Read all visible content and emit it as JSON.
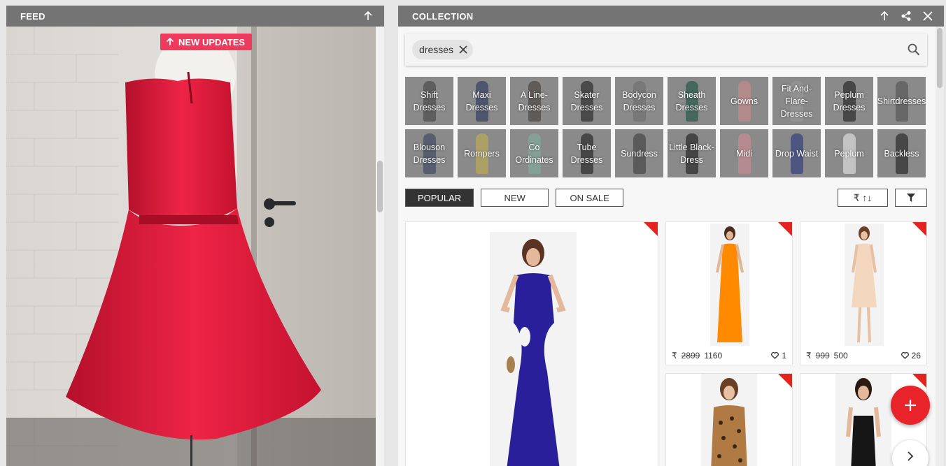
{
  "feed": {
    "title": "FEED",
    "new_updates_label": "NEW UPDATES",
    "icons": {
      "scroll_top": "arrow-up-icon",
      "new_updates": "arrow-up-icon"
    }
  },
  "collection": {
    "title": "COLLECTION",
    "header_icons": [
      "arrow-up-icon",
      "share-icon",
      "close-icon"
    ],
    "search": {
      "chip": "dresses",
      "chip_icon": "close-icon",
      "icon": "search-icon"
    },
    "categories": [
      {
        "label": "Shift Dresses",
        "color": "#3b3b3b"
      },
      {
        "label": "Maxi Dresses",
        "color": "#1e2b55"
      },
      {
        "label": "A Line-Dresses",
        "color": "#3a3530"
      },
      {
        "label": "Skater Dresses",
        "color": "#151515"
      },
      {
        "label": "Bodycon Dresses",
        "color": "#6a6a6a"
      },
      {
        "label": "Sheath Dresses",
        "color": "#0f4a3a"
      },
      {
        "label": "Gowns",
        "color": "#d38a8a"
      },
      {
        "label": "Fit And-Flare-Dresses",
        "color": "#9a9a9a"
      },
      {
        "label": "Peplum Dresses",
        "color": "#111111"
      },
      {
        "label": "Shirtdresses",
        "color": "#4a4a4a"
      },
      {
        "label": "Blouson Dresses",
        "color": "#2c3a5a"
      },
      {
        "label": "Rompers",
        "color": "#c9b24a"
      },
      {
        "label": "Co Ordinates",
        "color": "#7fb3a0"
      },
      {
        "label": "Tube Dresses",
        "color": "#111111"
      },
      {
        "label": "Sundress",
        "color": "#333333"
      },
      {
        "label": "Little Black-Dress",
        "color": "#0d0d0d"
      },
      {
        "label": "Midi",
        "color": "#d98c95"
      },
      {
        "label": "Drop Waist",
        "color": "#1d2a7a"
      },
      {
        "label": "Peplum",
        "color": "#f2f2f2"
      },
      {
        "label": "Backless",
        "color": "#111111"
      }
    ],
    "tabs": [
      {
        "label": "POPULAR",
        "active": true
      },
      {
        "label": "NEW",
        "active": false
      },
      {
        "label": "ON SALE",
        "active": false
      }
    ],
    "sort_label": "₹ ↑↓",
    "filter_icon": "filter-icon",
    "currency": "₹",
    "products": [
      {
        "name": "blue-cutout-maxi",
        "dress_color": "#2a1f9a"
      },
      {
        "name": "orange-maxi",
        "old_price": "2899",
        "price": "1160",
        "likes": "1",
        "dress_color": "#ff8a00"
      },
      {
        "name": "peach-midi",
        "old_price": "999",
        "price": "500",
        "likes": "26",
        "dress_color": "#f2d6bd"
      },
      {
        "name": "leopard-print-dress",
        "dress_color": "#b07a45"
      },
      {
        "name": "black-strappy-dress",
        "dress_color": "#161616"
      }
    ],
    "fab_icon": "plus-icon",
    "next_icon": "chevron-right-icon",
    "ribbon_color": "#e4231f"
  }
}
